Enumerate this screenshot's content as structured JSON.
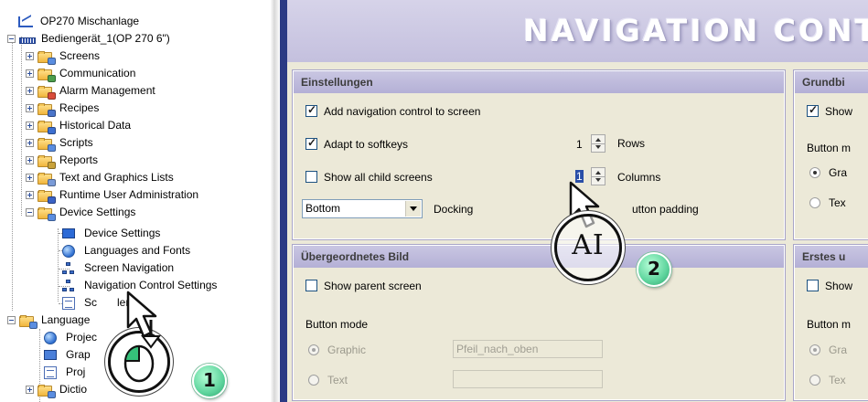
{
  "tree": {
    "root": "OP270 Mischanlage",
    "device": "Bediengerät_1(OP 270 6\")",
    "items": [
      "Screens",
      "Communication",
      "Alarm Management",
      "Recipes",
      "Historical Data",
      "Scripts",
      "Reports",
      "Text and Graphics Lists",
      "Runtime User Administration",
      "Device Settings"
    ],
    "device_settings_children": [
      "Device Settings",
      "Languages and Fonts",
      "Screen Navigation",
      "Navigation Control Settings",
      "Scheduler"
    ],
    "scheduler_visible": "Sc",
    "scheduler_tail": "ler",
    "language": {
      "label": "Language",
      "children": [
        "Projec",
        "Grap",
        "Proj",
        "Dictio"
      ]
    }
  },
  "banner": {
    "title": "NAVIGATION CONT"
  },
  "settings": {
    "title": "Einstellungen",
    "add_nav": "Add navigation control to screen",
    "adapt": "Adapt to softkeys",
    "show_child": "Show all child screens",
    "rows_value": "1",
    "rows_label": "Rows",
    "columns_value": "1",
    "columns_label": "Columns",
    "docking_value": "Bottom",
    "docking_label": "Docking",
    "padding_label": "utton padding"
  },
  "parent": {
    "title": "Übergeordnetes Bild",
    "show_parent": "Show parent screen",
    "button_mode": "Button mode",
    "graphic": "Graphic",
    "text": "Text",
    "graphic_value": "Pfeil_nach_oben"
  },
  "right_top": {
    "title": "Grundbi",
    "show": "Show",
    "button_mode": "Button m",
    "graphic": "Gra",
    "text": "Tex"
  },
  "right_bottom": {
    "title": "Erstes u",
    "show": "Show",
    "button_mode": "Button m",
    "graphic": "Gra",
    "text": "Tex"
  },
  "annotations": {
    "step1": "1",
    "step2": "2",
    "text_cursor": "AI"
  },
  "colors": {
    "accent_bar": "#2b3a84",
    "banner": "#c8c4e0",
    "group_header": "#bcb8da",
    "badge": "#5ed49d"
  }
}
